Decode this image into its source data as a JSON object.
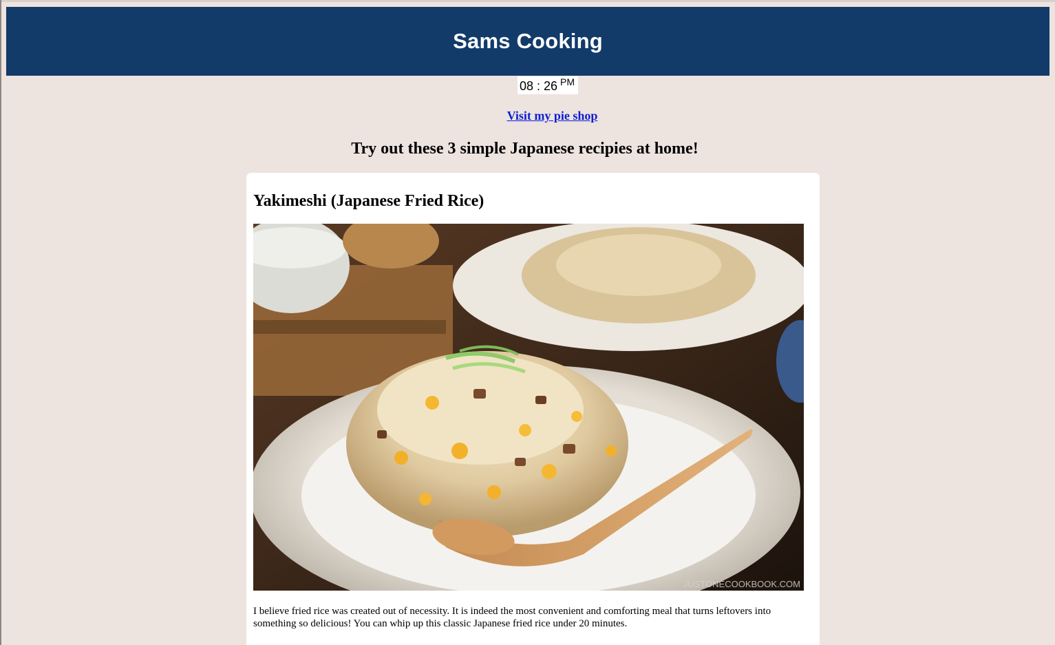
{
  "header": {
    "title": "Sams Cooking"
  },
  "clock": {
    "time": "08 : 26",
    "period": "PM"
  },
  "nav": {
    "pie_shop_link": "Visit my pie shop"
  },
  "intro": {
    "heading": "Try out these 3 simple Japanese recipies at home!"
  },
  "recipe": {
    "title": "Yakimeshi (Japanese Fried Rice)",
    "image_watermark": "JUSTONECOOKBOOK.COM",
    "description": "I believe fried rice was created out of necessity. It is indeed the most convenient and comforting meal that turns leftovers into something so delicious! You can whip up this classic Japanese fried rice under 20 minutes."
  },
  "colors": {
    "header_bg": "#133b69",
    "page_bg": "#ede3df",
    "link": "#0b1ed6"
  }
}
